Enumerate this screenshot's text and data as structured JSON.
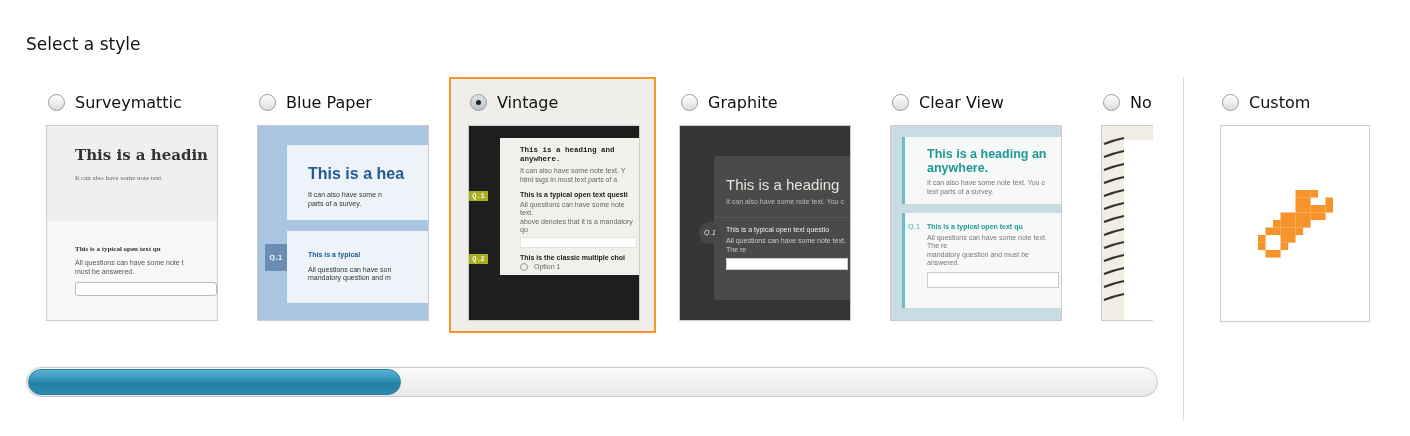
{
  "title": "Select a style",
  "styles": [
    {
      "label": "Surveymattic",
      "selected": false,
      "preview": {
        "kind": "classic",
        "heading": [
          "This is a headin"
        ],
        "note": [
          "It can also have some note text."
        ],
        "questions": [
          {
            "title": "This is a typical open text qu",
            "note": [
              "All questions can have some note t",
              "must be answered."
            ],
            "input": true
          }
        ]
      }
    },
    {
      "label": "Blue Paper",
      "selected": false,
      "preview": {
        "kind": "blue",
        "heading": [
          "This is a hea"
        ],
        "note": [
          "It can also have some n",
          "parts of a survey."
        ],
        "questions": [
          {
            "number": "Q.1",
            "title": "This is a typical",
            "note": [
              "All questions can have son",
              "mandatory question and m"
            ]
          }
        ]
      }
    },
    {
      "label": "Vintage",
      "selected": true,
      "preview": {
        "kind": "vintage",
        "heading": [
          "This is a heading and",
          "anywhere."
        ],
        "note": [
          "It can also have some note text. Y",
          "html tags in most text parts of a"
        ],
        "questions": [
          {
            "number": "Q.1",
            "title": "This is a typical open text questi",
            "note": [
              "All questions can have some note text.",
              "above denotes that it is a mandatory qu"
            ],
            "input": true
          },
          {
            "number": "Q.2",
            "title": "This is the classic multiple choi",
            "option": "Option 1"
          }
        ]
      }
    },
    {
      "label": "Graphite",
      "selected": false,
      "preview": {
        "kind": "graphite",
        "heading": [
          "This is a heading"
        ],
        "note": [
          "It can also have some note text. You c"
        ],
        "questions": [
          {
            "number": "Q.1",
            "title": "This is a typical open text questio",
            "note": [
              "All questions can have some note text. The re"
            ],
            "input": true
          }
        ]
      }
    },
    {
      "label": "Clear View",
      "selected": false,
      "preview": {
        "kind": "clear",
        "heading": [
          "This is a heading an",
          "anywhere."
        ],
        "note": [
          "It can also have some note text. You c",
          "text parts of a survey."
        ],
        "questions": [
          {
            "number": "Q.1",
            "title": "This is a typical open text qu",
            "note": [
              "All questions can have some note text. The re",
              "mandatory question and must be answered."
            ],
            "input": true
          }
        ]
      }
    },
    {
      "label": "No",
      "selected": false,
      "preview": {
        "kind": "notebook"
      }
    }
  ],
  "custom": {
    "label": "Custom",
    "selected": false
  }
}
